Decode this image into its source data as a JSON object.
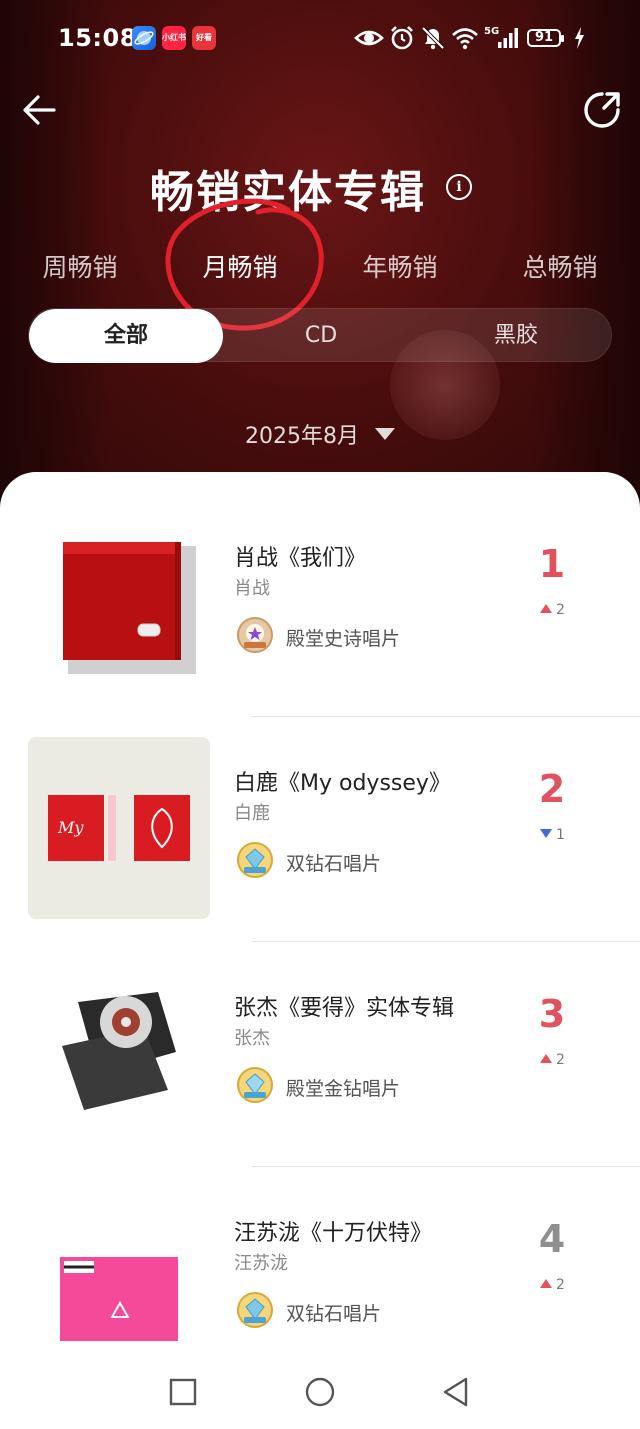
{
  "status_bar": {
    "time": "15:08",
    "network": "5G",
    "battery": "91",
    "app_icons": [
      "小红书",
      "好看"
    ]
  },
  "header": {
    "title": "畅销实体专辑",
    "back_icon": "back-arrow-icon",
    "share_icon": "share-icon",
    "info_icon": "i"
  },
  "period_tabs": [
    {
      "label": "周畅销",
      "active": false
    },
    {
      "label": "月畅销",
      "active": true
    },
    {
      "label": "年畅销",
      "active": false
    },
    {
      "label": "总畅销",
      "active": false
    }
  ],
  "format_tabs": [
    {
      "label": "全部",
      "active": true
    },
    {
      "label": "CD",
      "active": false
    },
    {
      "label": "黑胶",
      "active": false
    }
  ],
  "date_selector": {
    "value": "2025年8月"
  },
  "albums": [
    {
      "rank": "1",
      "title": "肖战《我们》",
      "artist": "肖战",
      "badge": "殿堂史诗唱片",
      "change_dir": "up",
      "change": "2"
    },
    {
      "rank": "2",
      "title": "白鹿《My odyssey》",
      "artist": "白鹿",
      "badge": "双钻石唱片",
      "change_dir": "down",
      "change": "1"
    },
    {
      "rank": "3",
      "title": "张杰《要得》实体专辑",
      "artist": "张杰",
      "badge": "殿堂金钻唱片",
      "change_dir": "up",
      "change": "2"
    },
    {
      "rank": "4",
      "title": "汪苏泷《十万伏特》",
      "artist": "汪苏泷",
      "badge": "双钻石唱片",
      "change_dir": "up",
      "change": "2"
    }
  ],
  "colors": {
    "accent_red": "#e2515e",
    "down_blue": "#3b6fd0",
    "hero_bg": "#4a0d0d",
    "annotation_red": "#e0202a"
  }
}
